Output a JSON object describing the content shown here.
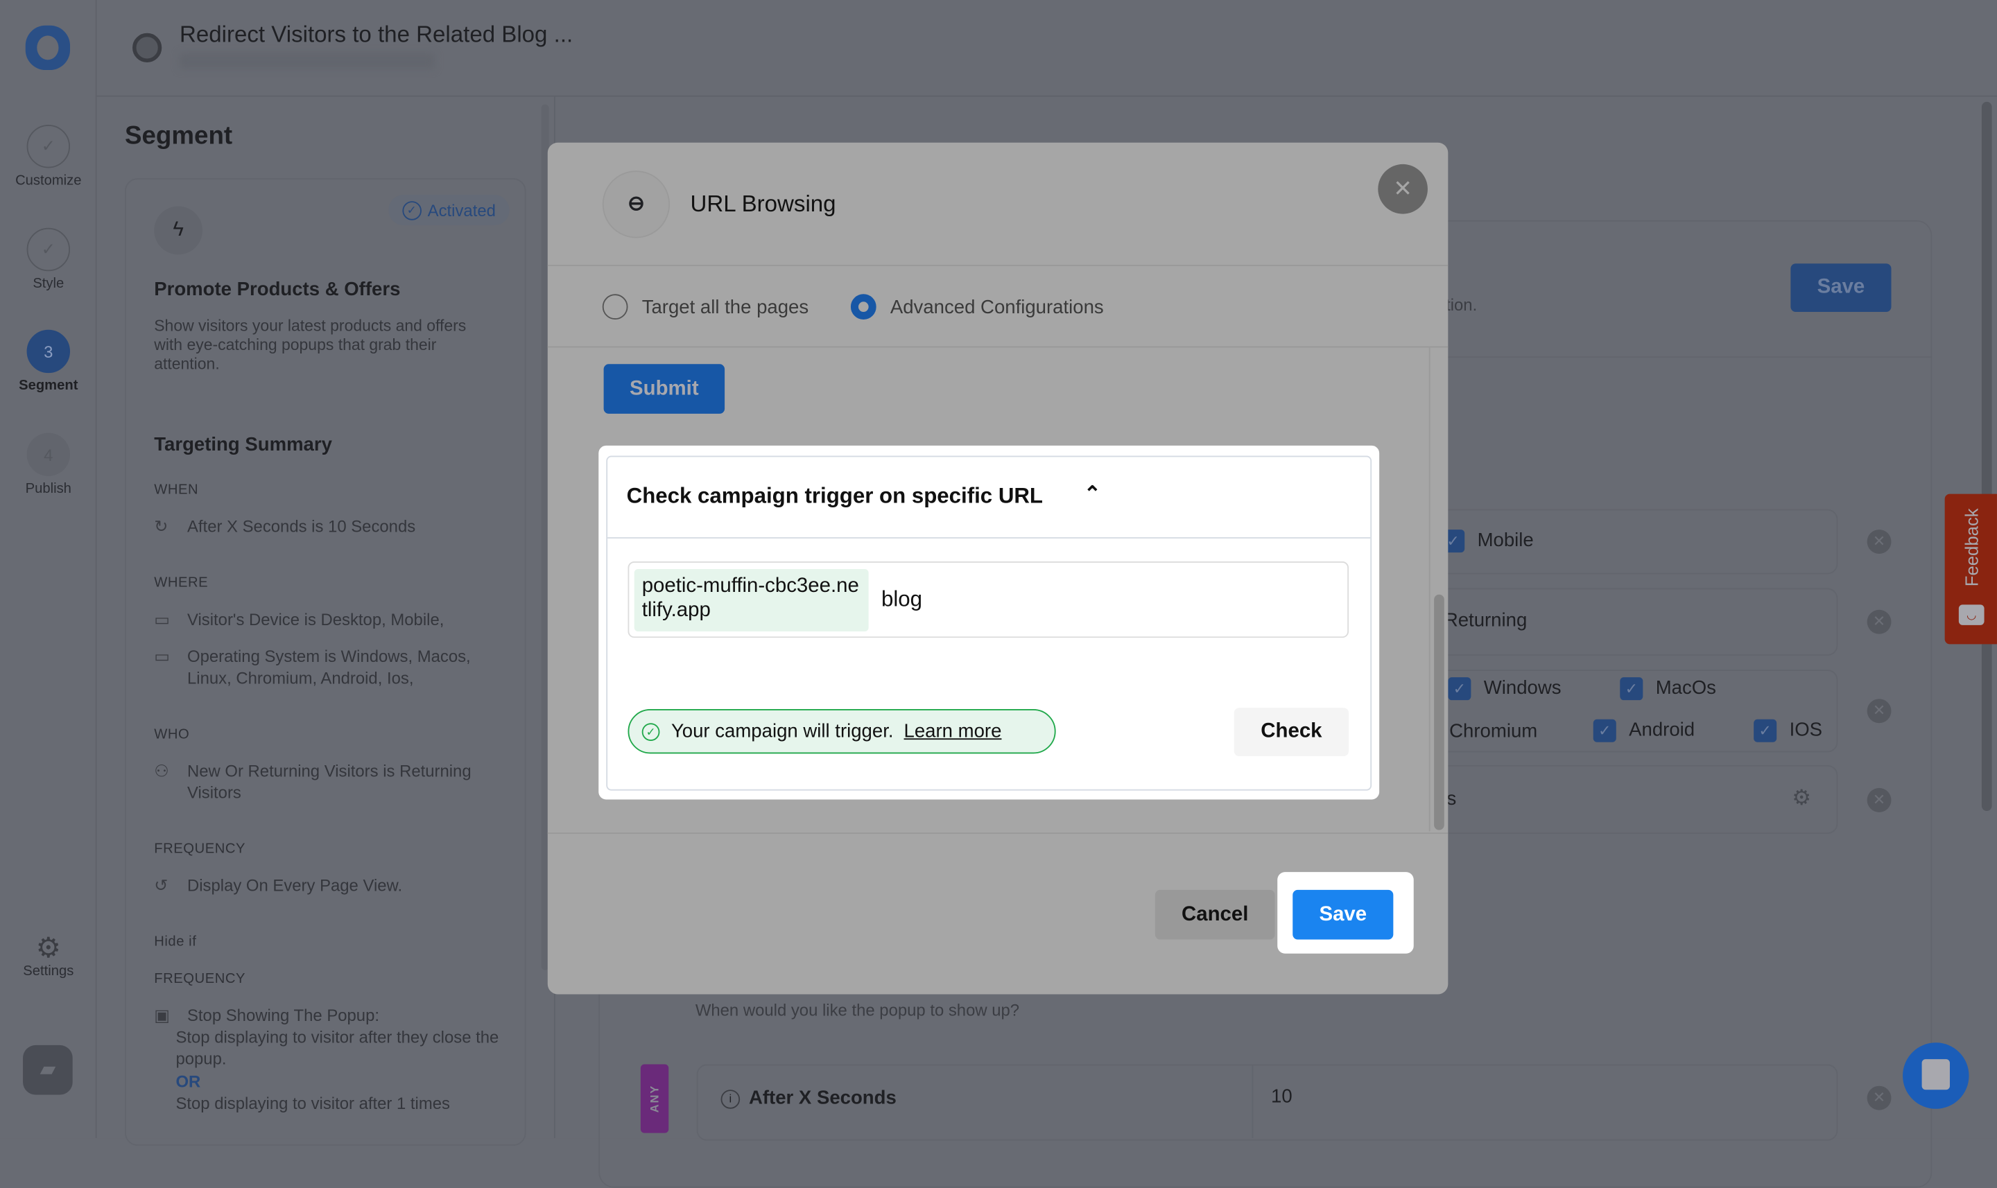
{
  "header": {
    "title": "Redirect Visitors to the Related Blog ..."
  },
  "nav": {
    "items": [
      {
        "label": "Customize",
        "state": "done"
      },
      {
        "label": "Style",
        "state": "done"
      },
      {
        "label": "Segment",
        "number": "3",
        "state": "active"
      },
      {
        "label": "Publish",
        "number": "4",
        "state": "pending"
      }
    ],
    "settings": "Settings"
  },
  "panel": {
    "title": "Segment",
    "badge": "Activated",
    "card_title": "Promote Products & Offers",
    "card_desc": "Show visitors your latest products and offers with eye-catching popups that grab their attention.",
    "summary_title": "Targeting Summary",
    "when_label": "WHEN",
    "when": "After X Seconds is 10 Seconds",
    "where_label": "WHERE",
    "where1": "Visitor's Device is Desktop, Mobile,",
    "where2": "Operating System is Windows, Macos, Linux, Chromium, Android, Ios,",
    "who_label": "WHO",
    "who": "New Or Returning Visitors is Returning Visitors",
    "freq_label": "FREQUENCY",
    "freq": "Display On Every Page View.",
    "hide_label": "Hide if",
    "freq2_label": "FREQUENCY",
    "stop_title": "Stop Showing The Popup:",
    "stop1": "Stop displaying to visitor after they close the popup.",
    "or": "OR",
    "stop2": "Stop displaying to visitor after 1 times"
  },
  "main": {
    "save": "Save",
    "partial_desc": "ation.",
    "mobile": "Mobile",
    "returning": "Returning",
    "os": [
      "Windows",
      "MacOs",
      "Chromium",
      "Android",
      "IOS"
    ],
    "partial_s": "s",
    "question": "When would you like the popup to show up?",
    "any": "ANY",
    "trigger_name": "After X Seconds",
    "trigger_value": "10"
  },
  "feedback": "Feedback",
  "modal": {
    "title": "URL Browsing",
    "radio_all": "Target all the pages",
    "radio_adv": "Advanced Configurations",
    "selected": "Advanced Configurations",
    "submit": "Submit",
    "check_title": "Check campaign trigger on specific URL",
    "domain": "poetic-muffin-cbc3ee.netlify.app",
    "path": "blog",
    "status": "Your campaign will trigger.",
    "learn_more": "Learn more",
    "check": "Check",
    "cancel": "Cancel",
    "save": "Save"
  },
  "colors": {
    "brand": "#1a84f0",
    "success": "#20a84a",
    "feedback": "#8a2410",
    "any_badge": "#6a2a7a"
  }
}
